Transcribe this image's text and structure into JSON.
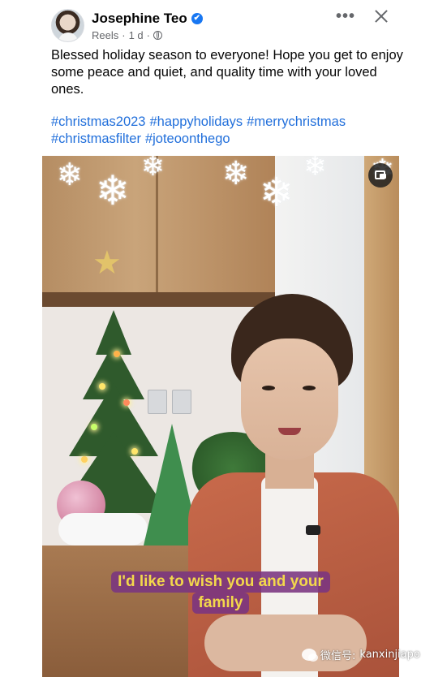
{
  "post": {
    "author_name": "Josephine Teo",
    "verified_icon": "✔",
    "section": "Reels",
    "separator": "·",
    "time": "1 d",
    "more_label": "•••"
  },
  "caption": "Blessed holiday season to everyone! Hope you get to enjoy some peace and quiet, and quality time with your loved ones.",
  "hashtags": [
    "#christmas2023",
    "#happyholidays",
    "#merrychristmas",
    "#christmasfilter",
    "#joteoonthego"
  ],
  "video": {
    "subtitle_line1": "I'd like to wish you and your",
    "subtitle_line2": "family",
    "snowflake_glyph": "❄",
    "star_glyph": "★"
  },
  "watermark": {
    "prefix": "微信号:",
    "handle": "kanxinjiapo"
  },
  "colors": {
    "link": "#216fdb",
    "verified": "#1877f2",
    "subtitle_text": "#f3d84b",
    "subtitle_bg": "#7a3481"
  }
}
